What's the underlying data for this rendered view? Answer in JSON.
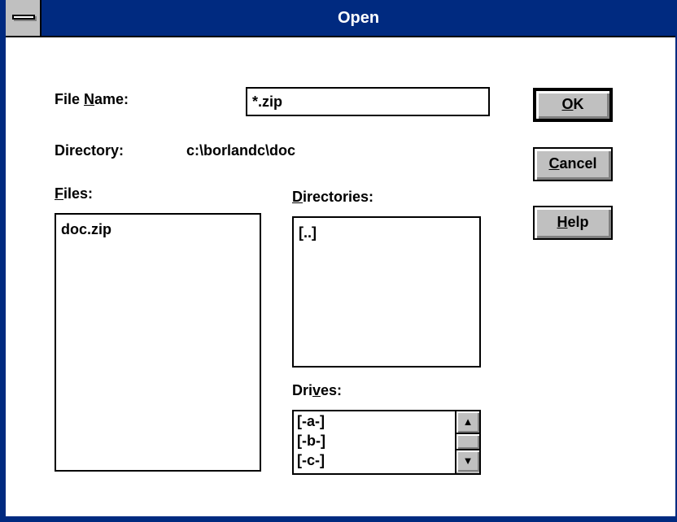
{
  "window": {
    "title": "Open"
  },
  "file_name": {
    "label_before": "File ",
    "label_mnemonic": "N",
    "label_after": "ame:",
    "value": "*.zip"
  },
  "directory": {
    "label": "Directory:",
    "path": "c:\\borlandc\\doc"
  },
  "files": {
    "label_mnemonic": "F",
    "label_after": "iles:",
    "items": [
      "doc.zip"
    ]
  },
  "directories": {
    "label_mnemonic": "D",
    "label_after": "irectories:",
    "items": [
      "[..]"
    ]
  },
  "drives": {
    "label_before": "Dri",
    "label_mnemonic": "v",
    "label_after": "es:",
    "items": [
      "[-a-]",
      "[-b-]",
      "[-c-]"
    ]
  },
  "buttons": {
    "ok": {
      "mnemonic": "O",
      "rest": "K"
    },
    "cancel": {
      "mnemonic": "C",
      "rest": "ancel"
    },
    "help": {
      "mnemonic": "H",
      "rest": "elp"
    }
  },
  "scroll": {
    "up_glyph": "▲",
    "down_glyph": "▼"
  },
  "colors": {
    "titlebar": "#002a80",
    "title_text": "#ffffff",
    "button_face": "#c0c0c0",
    "background": "#ffffff"
  }
}
